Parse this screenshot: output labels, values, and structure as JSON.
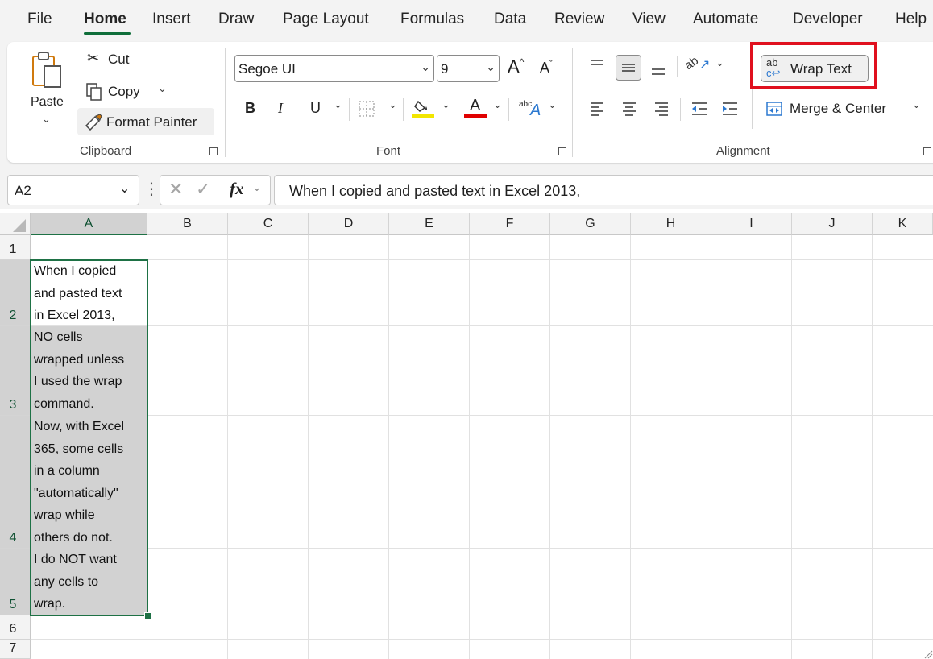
{
  "menu": {
    "tabs": [
      "File",
      "Home",
      "Insert",
      "Draw",
      "Page Layout",
      "Formulas",
      "Data",
      "Review",
      "View",
      "Automate",
      "Developer",
      "Help"
    ],
    "active": "Home"
  },
  "clipboard": {
    "paste_label": "Paste",
    "cut_label": "Cut",
    "copy_label": "Copy",
    "format_painter_label": "Format Painter",
    "group_label": "Clipboard"
  },
  "font": {
    "family": "Segoe UI",
    "size": "9",
    "group_label": "Font",
    "bold": "B",
    "italic": "I",
    "underline": "U",
    "grow": "A",
    "shrink": "A",
    "font_color_letter": "A",
    "highlight_color": "#f2e600",
    "font_color": "#e00000"
  },
  "alignment": {
    "wrap_text_label": "Wrap Text",
    "merge_center_label": "Merge & Center",
    "group_label": "Alignment",
    "highlight_border": "#e0101e"
  },
  "formula_bar": {
    "name_box": "A2",
    "fx": "fx",
    "content": "When I copied and pasted text in Excel 2013,"
  },
  "grid": {
    "columns": [
      "A",
      "B",
      "C",
      "D",
      "E",
      "F",
      "G",
      "H",
      "I",
      "J",
      "K"
    ],
    "rows": [
      "1",
      "2",
      "3",
      "4",
      "5",
      "6",
      "7"
    ],
    "cells": {
      "A2": "When I copied\nand pasted text\nin Excel 2013,",
      "A3": "NO cells\nwrapped unless\nI used the wrap\ncommand.",
      "A4": "Now, with Excel\n365, some cells\nin a column\n\"automatically\"\nwrap while\nothers do not.",
      "A5": "I do NOT want\nany cells to\nwrap."
    },
    "selection_color": "#1e7145"
  }
}
